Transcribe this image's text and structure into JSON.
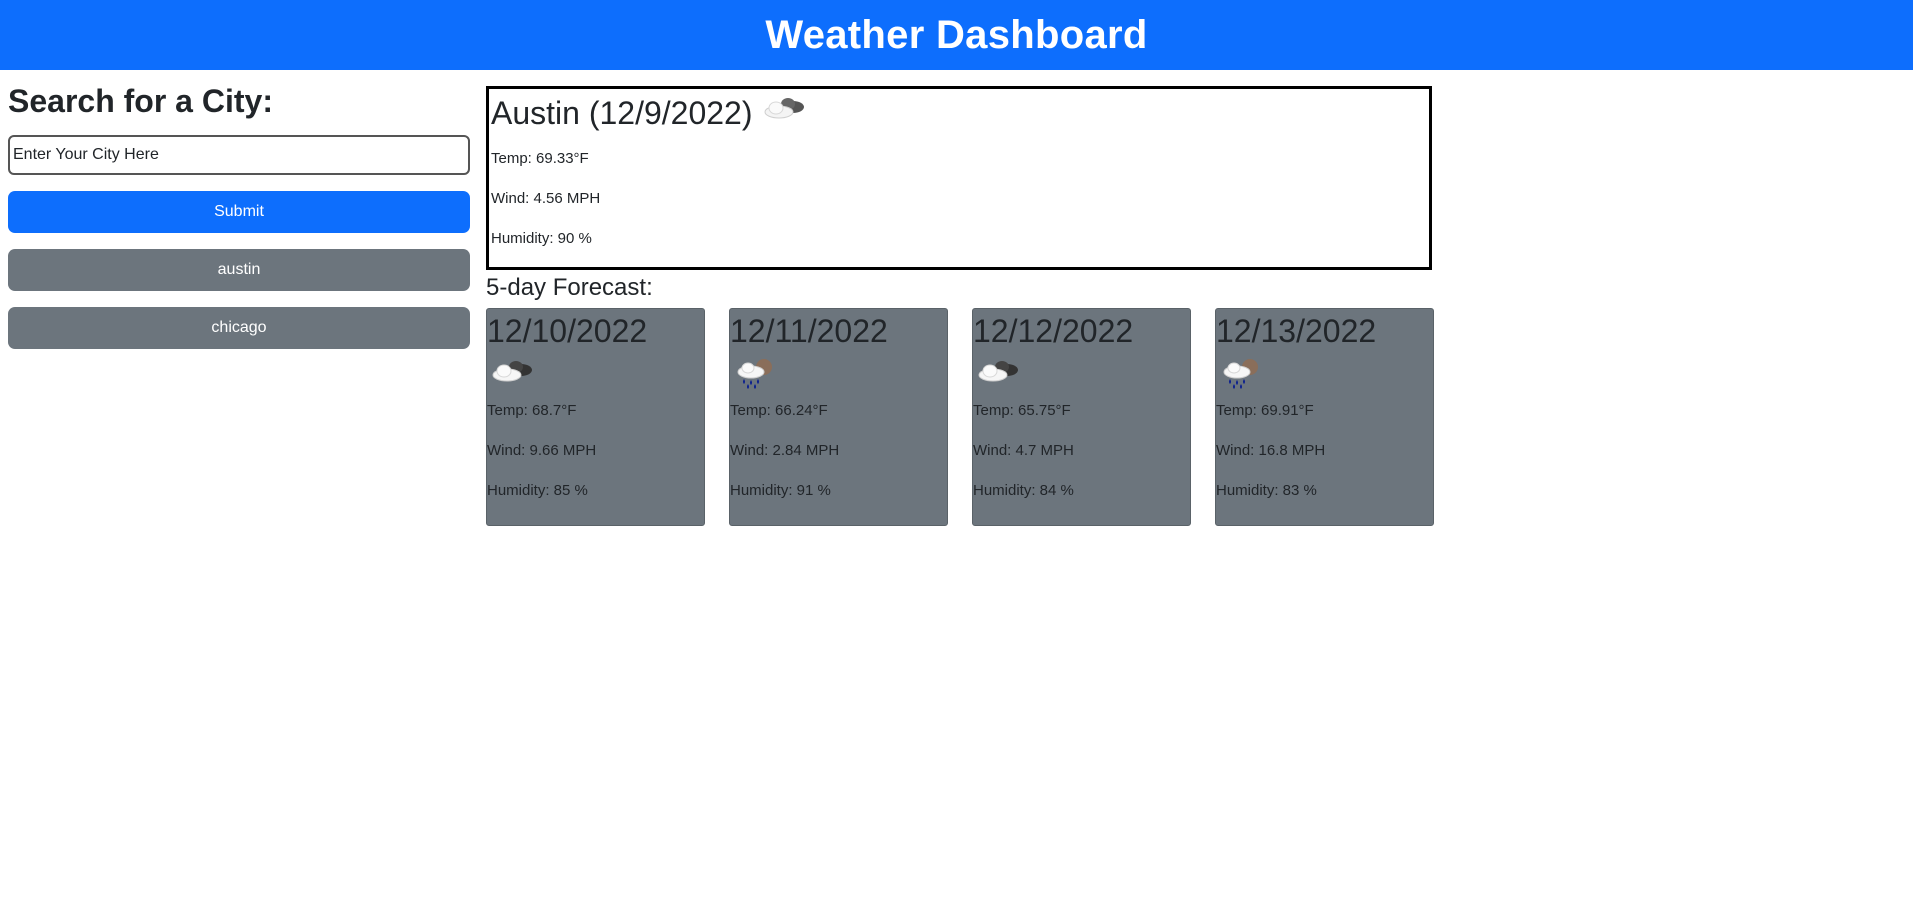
{
  "header": {
    "title": "Weather Dashboard"
  },
  "sidebar": {
    "heading": "Search for a City:",
    "search": {
      "placeholder": "Enter Your City Here",
      "value": ""
    },
    "submit_label": "Submit",
    "history": [
      "austin",
      "chicago"
    ]
  },
  "current": {
    "title": "Austin (12/9/2022)",
    "icon": "cloudy-icon",
    "temp": "Temp: 69.33°F",
    "wind": "Wind: 4.56 MPH",
    "humidity": "Humidity: 90 %"
  },
  "forecast": {
    "heading": "5-day Forecast:",
    "days": [
      {
        "date": "12/10/2022",
        "icon": "cloudy-icon",
        "temp": "Temp: 68.7°F",
        "wind": "Wind: 9.66 MPH",
        "humidity": "Humidity: 85 %"
      },
      {
        "date": "12/11/2022",
        "icon": "rain-icon",
        "temp": "Temp: 66.24°F",
        "wind": "Wind: 2.84 MPH",
        "humidity": "Humidity: 91 %"
      },
      {
        "date": "12/12/2022",
        "icon": "cloudy-icon",
        "temp": "Temp: 65.75°F",
        "wind": "Wind: 4.7 MPH",
        "humidity": "Humidity: 84 %"
      },
      {
        "date": "12/13/2022",
        "icon": "rain-icon",
        "temp": "Temp: 69.91°F",
        "wind": "Wind: 16.8 MPH",
        "humidity": "Humidity: 83 %"
      }
    ]
  },
  "colors": {
    "primary": "#0d6efd",
    "secondary": "#6c757d",
    "text": "#212529"
  }
}
